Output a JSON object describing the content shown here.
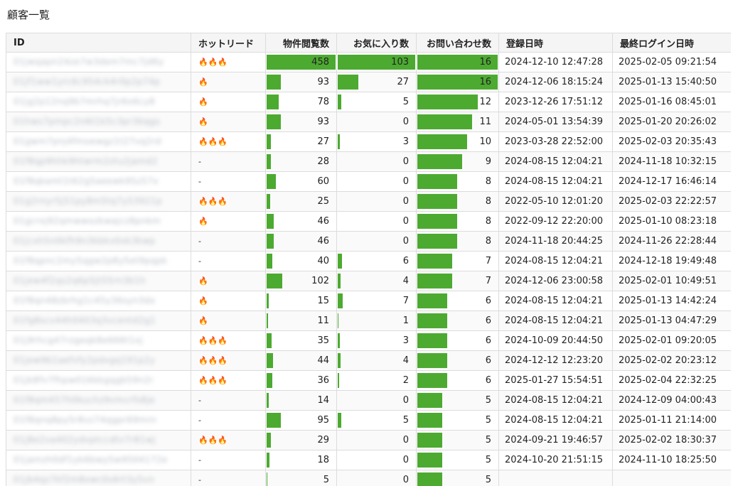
{
  "page": {
    "title": "顧客一覧"
  },
  "table": {
    "headers": {
      "id": "ID",
      "hot": "ホットリード",
      "views": "物件閲覧数",
      "favorites": "お気に入り数",
      "inquiries": "お問い合わせ数",
      "registered": "登録日時",
      "last_login": "最終ログイン日時"
    },
    "maxima": {
      "views": 458,
      "favorites": 103,
      "inquiries": 16
    },
    "rows": [
      {
        "id": "01jwqapn24ze7w3dem7mc7jd6y",
        "hot": 3,
        "hot_text": "🔥🔥🔥",
        "views": 458,
        "favorites": 103,
        "inquiries": 16,
        "registered": "2024-12-10 12:47:28",
        "last_login": "2025-02-05 09:21:54"
      },
      {
        "id": "01jf1ww1yrc6c954ck4r0p2p74p",
        "hot": 1,
        "hot_text": "🔥",
        "views": 93,
        "favorites": 27,
        "inquiries": 16,
        "registered": "2024-12-06 18:15:24",
        "last_login": "2025-01-13 15:40:50"
      },
      {
        "id": "01jg2p12nq9b7mrhq7jr6x6cy8",
        "hot": 1,
        "hot_text": "🔥",
        "views": 78,
        "favorites": 5,
        "inquiries": 12,
        "registered": "2023-12-26 17:51:12",
        "last_login": "2025-01-16 08:45:01"
      },
      {
        "id": "01hws7pmpc2n6t1k5c3pr3bqgs",
        "hot": 1,
        "hot_text": "🔥",
        "views": 93,
        "favorites": 0,
        "inquiries": 11,
        "registered": "2024-05-01 13:54:39",
        "last_login": "2025-01-20 20:26:02"
      },
      {
        "id": "01gwm7pnj4fmoewgz1t27vq2rd",
        "hot": 3,
        "hot_text": "🔥🔥🔥",
        "views": 27,
        "favorites": 3,
        "inquiries": 10,
        "registered": "2023-03-28 22:52:00",
        "last_login": "2025-02-03 20:35:43"
      },
      {
        "id": "01f8qp9hhk9htwrm2ztu2jamd2",
        "hot": 0,
        "hot_text": "-",
        "views": 28,
        "favorites": 0,
        "inquiries": 9,
        "registered": "2024-08-15 12:04:21",
        "last_login": "2024-11-18 10:32:15"
      },
      {
        "id": "01f8qkamt1t62g5aeewk95z57x",
        "hot": 0,
        "hot_text": "-",
        "views": 60,
        "favorites": 0,
        "inquiries": 8,
        "registered": "2024-08-15 12:04:21",
        "last_login": "2024-12-17 16:46:14"
      },
      {
        "id": "01g2rnyr5j51py8m5tq7y53921p",
        "hot": 3,
        "hot_text": "🔥🔥🔥",
        "views": 25,
        "favorites": 0,
        "inquiries": 8,
        "registered": "2022-05-10 12:01:20",
        "last_login": "2025-02-03 22:22:57"
      },
      {
        "id": "01gcrxj92qmwwozkwajcz8pnkm",
        "hot": 1,
        "hot_text": "🔥",
        "views": 46,
        "favorites": 0,
        "inquiries": 8,
        "registered": "2022-09-12 22:20:00",
        "last_login": "2025-01-10 08:23:18"
      },
      {
        "id": "01jcxh5n0kfh9n3kbkv0xk3kwp",
        "hot": 0,
        "hot_text": "-",
        "views": 46,
        "favorites": 0,
        "inquiries": 8,
        "registered": "2024-11-18 20:44:25",
        "last_login": "2024-11-26 22:28:44"
      },
      {
        "id": "01f8qpnc2my5qgw2p8y5et9pqpk",
        "hot": 0,
        "hot_text": "-",
        "views": 40,
        "favorites": 6,
        "inquiries": 7,
        "registered": "2024-08-15 12:04:21",
        "last_login": "2024-12-18 19:49:48"
      },
      {
        "id": "01jew4f2qs2q6p5jt55rn3b1h",
        "hot": 1,
        "hot_text": "🔥",
        "views": 102,
        "favorites": 4,
        "inquiries": 7,
        "registered": "2024-12-06 23:00:58",
        "last_login": "2025-02-01 10:49:51"
      },
      {
        "id": "01f8qn48zbrhg1c45y36syn3dx",
        "hot": 1,
        "hot_text": "🔥",
        "views": 15,
        "favorites": 7,
        "inquiries": 6,
        "registered": "2024-08-15 12:04:21",
        "last_login": "2025-01-13 14:42:24"
      },
      {
        "id": "01fg8scv44h0403q3vcentd2g1",
        "hot": 1,
        "hot_text": "🔥",
        "views": 11,
        "favorites": 1,
        "inquiries": 6,
        "registered": "2024-08-15 12:04:21",
        "last_login": "2025-01-13 04:47:29"
      },
      {
        "id": "01j9rhcg47rzgeqk8e666t1xj",
        "hot": 3,
        "hot_text": "🔥🔥🔥",
        "views": 35,
        "favorites": 3,
        "inquiries": 6,
        "registered": "2024-10-09 20:44:50",
        "last_login": "2025-02-01 09:20:05"
      },
      {
        "id": "01jew9b1aefvfy2pdxgq191p2y",
        "hot": 3,
        "hot_text": "🔥🔥🔥",
        "views": 44,
        "favorites": 4,
        "inquiries": 6,
        "registered": "2024-12-12 12:23:20",
        "last_login": "2025-02-02 20:23:12"
      },
      {
        "id": "01jk8fv7fhpw016kkgqgb59n2r",
        "hot": 3,
        "hot_text": "🔥🔥🔥",
        "views": 36,
        "favorites": 2,
        "inquiries": 6,
        "registered": "2025-01-27 15:54:51",
        "last_login": "2025-02-04 22:32:25"
      },
      {
        "id": "01f8qm457h0kuchz9vmcrfs8je",
        "hot": 0,
        "hot_text": "-",
        "views": 14,
        "favorites": 0,
        "inquiries": 5,
        "registered": "2024-08-15 12:04:21",
        "last_login": "2024-12-09 04:00:43"
      },
      {
        "id": "01f8qnq8py5r8vz74qgpr69mrn",
        "hot": 0,
        "hot_text": "-",
        "views": 95,
        "favorites": 5,
        "inquiries": 5,
        "registered": "2024-08-15 12:04:21",
        "last_login": "2025-01-11 21:14:00"
      },
      {
        "id": "01j8e2va402ydvptccdtv7r81wj",
        "hot": 3,
        "hot_text": "🔥🔥🔥",
        "views": 29,
        "favorites": 0,
        "inquiries": 5,
        "registered": "2024-09-21 19:46:57",
        "last_login": "2025-02-02 18:30:37"
      },
      {
        "id": "01jamzh0df1yk6bwy5w9504172e",
        "hot": 0,
        "hot_text": "-",
        "views": 18,
        "favorites": 0,
        "inquiries": 5,
        "registered": "2024-10-20 21:51:15",
        "last_login": "2024-11-10 18:25:50"
      },
      {
        "id": "01jb4qz7kf2m8xwc0s6rt3y5vn",
        "hot": 0,
        "hot_text": "-",
        "views": 5,
        "favorites": 0,
        "inquiries": 5,
        "registered": "",
        "last_login": ""
      }
    ]
  }
}
